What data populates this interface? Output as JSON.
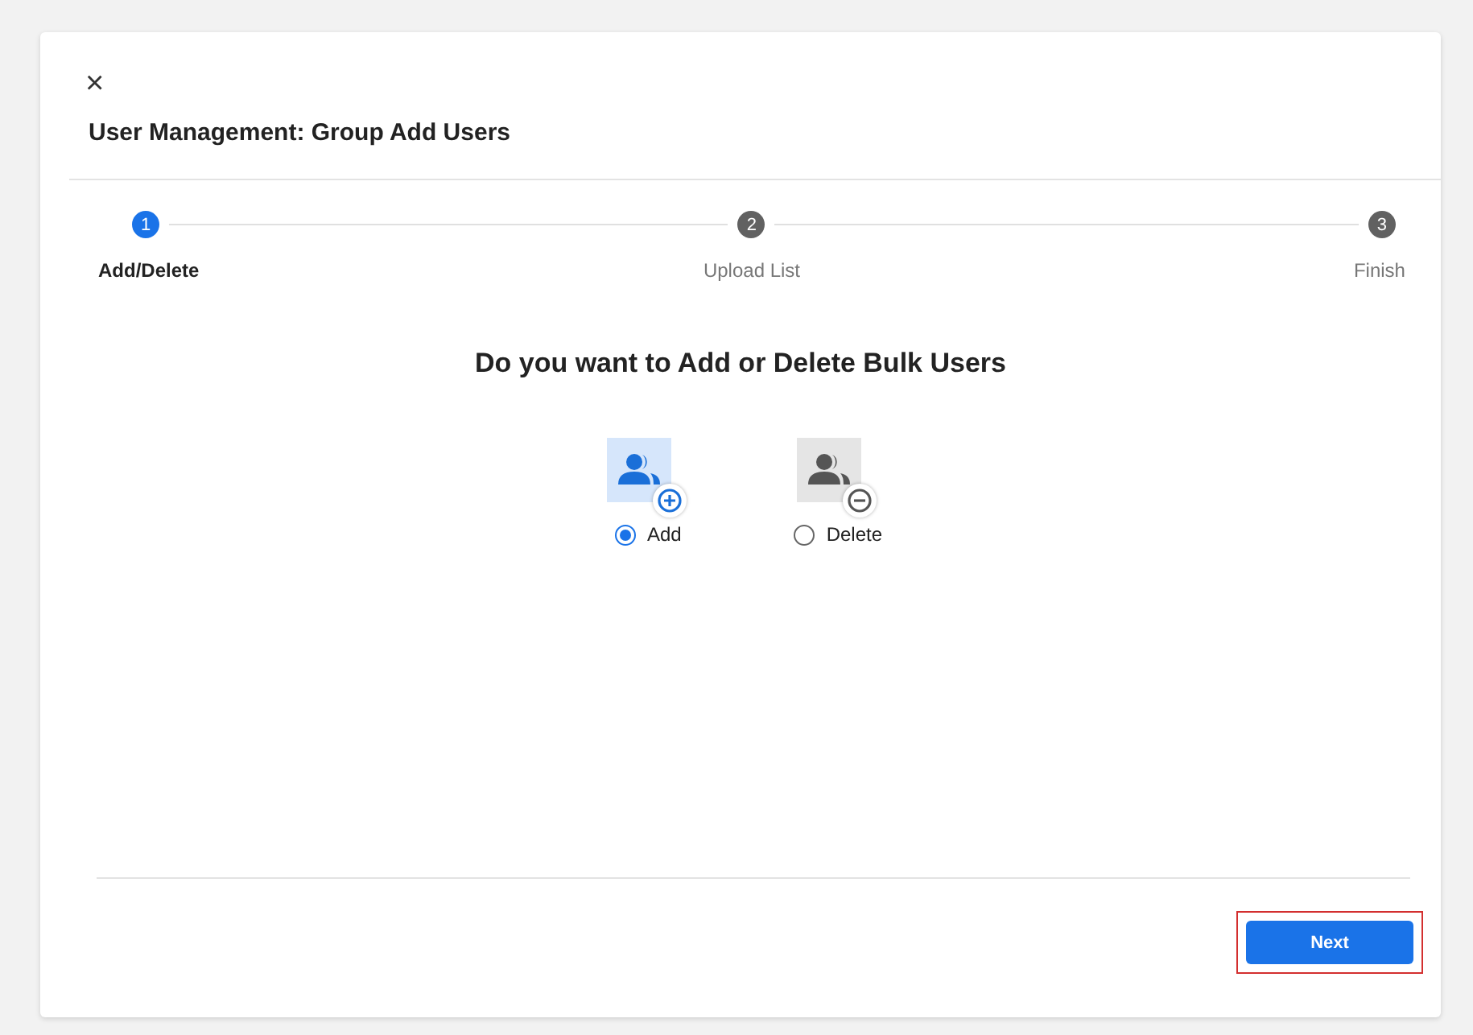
{
  "dialog": {
    "close": "×",
    "title": "User Management: Group Add Users"
  },
  "steps": [
    {
      "number": "1",
      "label": "Add/Delete",
      "selected": true
    },
    {
      "number": "2",
      "label": "Upload List",
      "selected": false
    },
    {
      "number": "3",
      "label": "Finish",
      "selected": false
    }
  ],
  "question": "Do you want to Add or Delete Bulk Users",
  "options": [
    {
      "kind": "add",
      "label": "Add",
      "selected": true
    },
    {
      "kind": "delete",
      "label": "Delete",
      "selected": false
    }
  ],
  "footer": {
    "next_button": "Next",
    "highlighted": true
  }
}
